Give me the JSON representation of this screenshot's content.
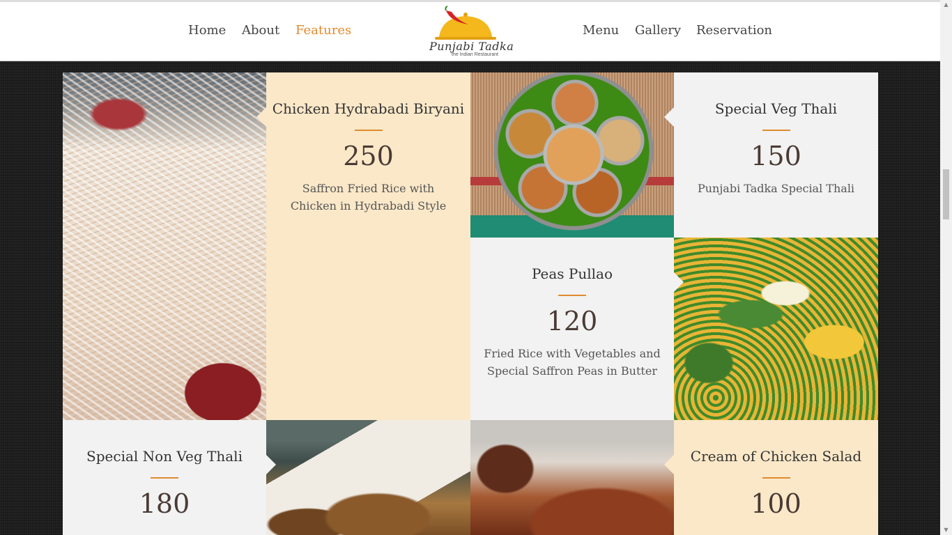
{
  "nav": {
    "left": [
      "Home",
      "About",
      "Features"
    ],
    "right": [
      "Menu",
      "Gallery",
      "Reservation"
    ],
    "active": "Features"
  },
  "logo": {
    "name": "Punjabi Tadka",
    "tagline": "the Indian Restaurant"
  },
  "colors": {
    "accent": "#e08b2e",
    "cream": "#fbe8c8",
    "grey": "#f2f2f2"
  },
  "items": [
    {
      "title": "Chicken Hydrabadi Biryani",
      "price": "250",
      "desc": "Saffron Fried Rice with Chicken in Hydrabadi Style"
    },
    {
      "title": "Special Veg Thali",
      "price": "150",
      "desc": "Punjabi Tadka Special Thali"
    },
    {
      "title": "Peas Pullao",
      "price": "120",
      "desc": "Fried Rice with Vegetables and Special Saffron Peas in Butter"
    },
    {
      "title": "Special Non Veg Thali",
      "price": "180",
      "desc": ""
    },
    {
      "title": "Cream of Chicken Salad",
      "price": "100",
      "desc": ""
    }
  ]
}
